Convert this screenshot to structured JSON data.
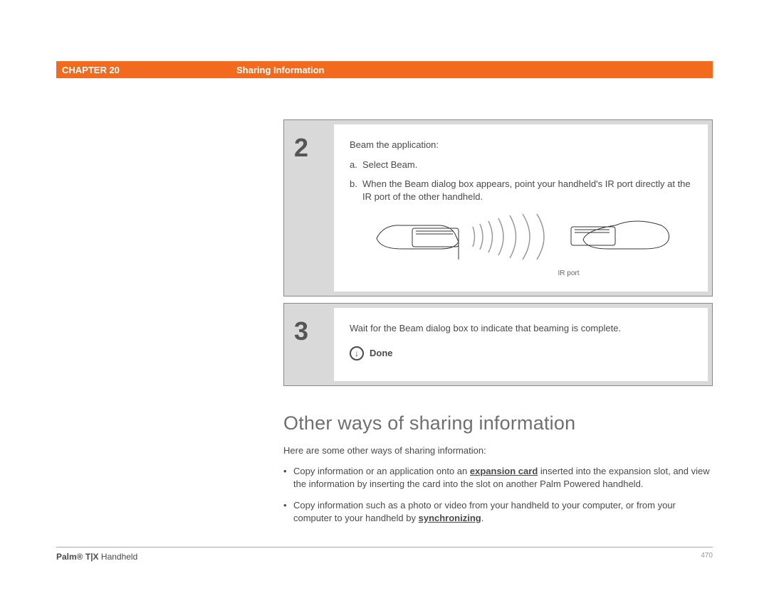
{
  "header": {
    "chapter": "CHAPTER 20",
    "title": "Sharing Information"
  },
  "steps": {
    "two": {
      "number": "2",
      "intro": "Beam the application:",
      "a_label": "a.",
      "a_text": "Select Beam.",
      "b_label": "b.",
      "b_text": "When the Beam dialog box appears, point your handheld's IR port directly at the IR port of the other handheld.",
      "ir_port_label": "IR port"
    },
    "three": {
      "number": "3",
      "text": "Wait for the Beam dialog box to indicate that beaming is complete.",
      "done_label": "Done"
    }
  },
  "section": {
    "heading": "Other ways of sharing information",
    "intro": "Here are some other ways of sharing information:",
    "bullet1_pre": "Copy information or an application onto an ",
    "bullet1_link": "expansion card",
    "bullet1_post": " inserted into the expansion slot, and view the information by inserting the card into the slot on another Palm Powered handheld.",
    "bullet2_pre": "Copy information such as a photo or video from your handheld to your computer, or from your computer to your handheld by ",
    "bullet2_link": "synchronizing",
    "bullet2_post": "."
  },
  "footer": {
    "product_bold": "Palm® T|X",
    "product_rest": " Handheld",
    "page": "470"
  }
}
